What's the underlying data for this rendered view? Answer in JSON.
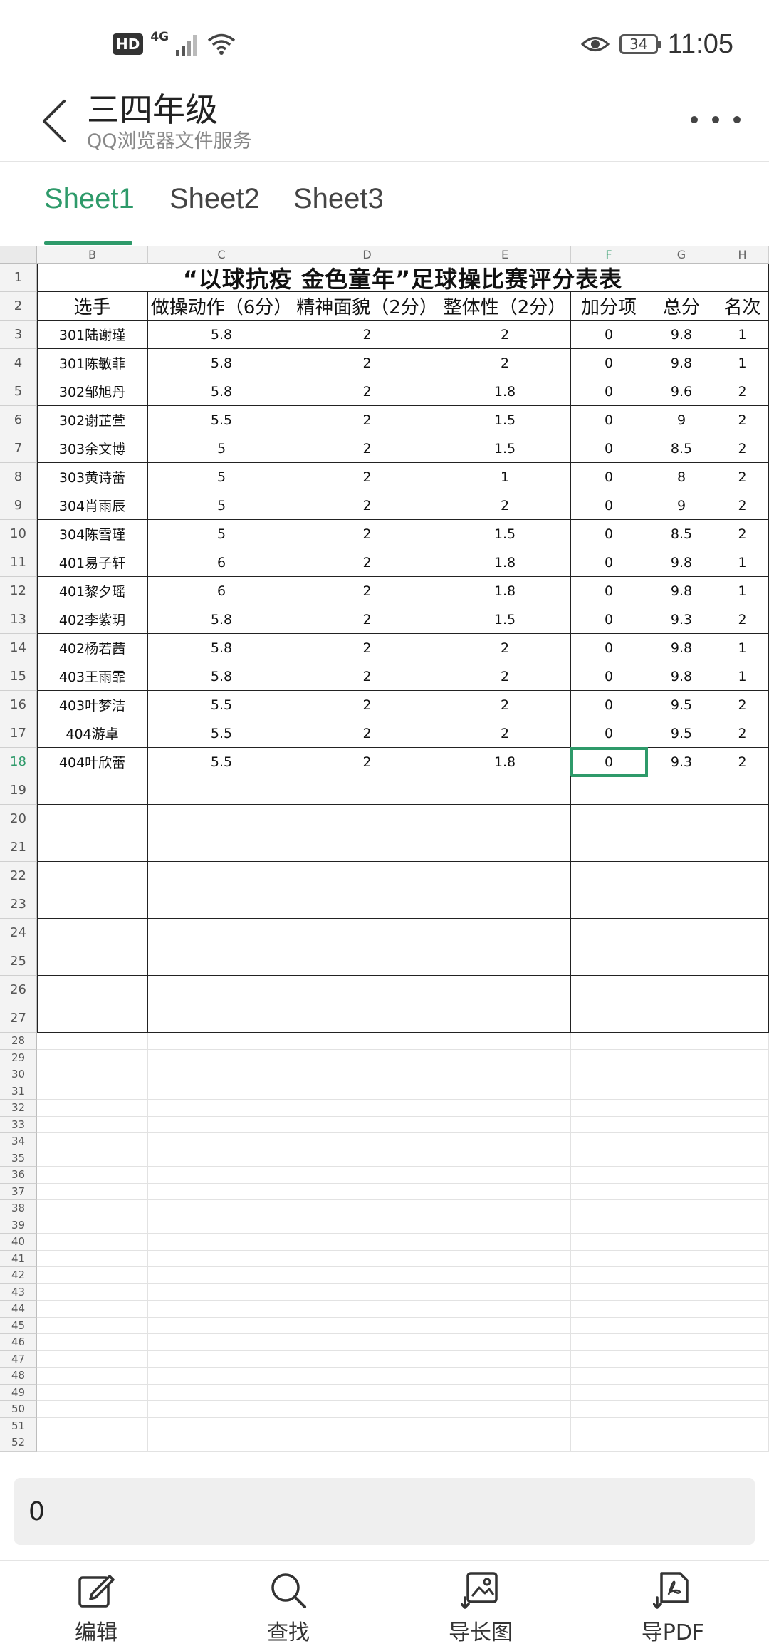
{
  "status_bar": {
    "hd_badge": "HD",
    "network": "4G",
    "battery_level": "34",
    "time": "11:05"
  },
  "header": {
    "title": "三四年级",
    "subtitle": "QQ浏览器文件服务"
  },
  "tabs": [
    {
      "label": "Sheet1",
      "active": true
    },
    {
      "label": "Sheet2",
      "active": false
    },
    {
      "label": "Sheet3",
      "active": false
    }
  ],
  "sheet": {
    "column_letters": [
      "B",
      "C",
      "D",
      "E",
      "F",
      "G",
      "H"
    ],
    "selected_column": "F",
    "title": "“以球抗疫 金色童年”足球操比赛评分表表",
    "headers": [
      "选手",
      "做操动作（6分）",
      "精神面貌（2分）",
      "整体性（2分）",
      "加分项",
      "总分",
      "名次"
    ],
    "rows": [
      [
        "301陆谢瑾",
        "5.8",
        "2",
        "2",
        "0",
        "9.8",
        "1"
      ],
      [
        "301陈敏菲",
        "5.8",
        "2",
        "2",
        "0",
        "9.8",
        "1"
      ],
      [
        "302邹旭丹",
        "5.8",
        "2",
        "1.8",
        "0",
        "9.6",
        "2"
      ],
      [
        "302谢芷萱",
        "5.5",
        "2",
        "1.5",
        "0",
        "9",
        "2"
      ],
      [
        "303余文博",
        "5",
        "2",
        "1.5",
        "0",
        "8.5",
        "2"
      ],
      [
        "303黄诗蕾",
        "5",
        "2",
        "1",
        "0",
        "8",
        "2"
      ],
      [
        "304肖雨辰",
        "5",
        "2",
        "2",
        "0",
        "9",
        "2"
      ],
      [
        "304陈雪瑾",
        "5",
        "2",
        "1.5",
        "0",
        "8.5",
        "2"
      ],
      [
        "401易子轩",
        "6",
        "2",
        "1.8",
        "0",
        "9.8",
        "1"
      ],
      [
        "401黎夕瑶",
        "6",
        "2",
        "1.8",
        "0",
        "9.8",
        "1"
      ],
      [
        "402李紫玥",
        "5.8",
        "2",
        "1.5",
        "0",
        "9.3",
        "2"
      ],
      [
        "402杨若茜",
        "5.8",
        "2",
        "2",
        "0",
        "9.8",
        "1"
      ],
      [
        "403王雨霏",
        "5.8",
        "2",
        "2",
        "0",
        "9.8",
        "1"
      ],
      [
        "403叶梦洁",
        "5.5",
        "2",
        "2",
        "0",
        "9.5",
        "2"
      ],
      [
        "404游卓",
        "5.5",
        "2",
        "2",
        "0",
        "9.5",
        "2"
      ],
      [
        "404叶欣蕾",
        "5.5",
        "2",
        "1.8",
        "0",
        "9.3",
        "2"
      ]
    ],
    "row_numbers": [
      "1",
      "2",
      "3",
      "4",
      "5",
      "6",
      "7",
      "8",
      "9",
      "10",
      "11",
      "12",
      "13",
      "14",
      "15",
      "16",
      "17",
      "18",
      "19",
      "20",
      "21",
      "22",
      "23",
      "24",
      "25",
      "26",
      "27",
      "28",
      "29",
      "30",
      "31",
      "32",
      "33",
      "34",
      "35",
      "36",
      "37",
      "38",
      "39",
      "40",
      "41",
      "42",
      "43",
      "44",
      "45",
      "46",
      "47",
      "48",
      "49",
      "50",
      "51",
      "52"
    ],
    "selected_row": "18",
    "selected_value": "0"
  },
  "toolbar": [
    {
      "label": "编辑",
      "icon": "edit-icon"
    },
    {
      "label": "查找",
      "icon": "search-icon"
    },
    {
      "label": "导长图",
      "icon": "long-image-icon"
    },
    {
      "label": "导PDF",
      "icon": "pdf-icon"
    }
  ],
  "colors": {
    "accent": "#2e9a6a"
  }
}
